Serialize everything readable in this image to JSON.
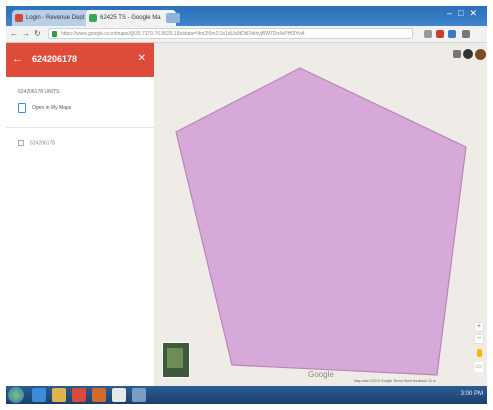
{
  "browser": {
    "tabs": [
      {
        "label": "Login - Revenue Dept"
      },
      {
        "label": "62425 TS - Google Ma"
      }
    ],
    "url": "https://www.google.co.in/maps/@30.7179,76.8029,18z/data=!4m2!6m1!1s1dUa9tDkFhkhyjBW7Dn4xPH0lYvi4"
  },
  "panel": {
    "title": "624206178",
    "subtitle": "624206178 UNITS",
    "open_label": "Open in My Maps",
    "layer_label": "624206178",
    "accent_color": "#dd4b39"
  },
  "map": {
    "logo": "Google",
    "footer": "Map data ©2019 Google   Terms   Send feedback   20 m",
    "polygon_fill": "#d7a9d8",
    "polygon_stroke": "#b887b6"
  },
  "icons": {
    "back": "arrow-left-icon",
    "close": "close-icon",
    "apps": "apps-icon",
    "notifications": "bell-icon",
    "account": "avatar-icon"
  },
  "taskbar": {
    "time": "3:00 PM"
  }
}
